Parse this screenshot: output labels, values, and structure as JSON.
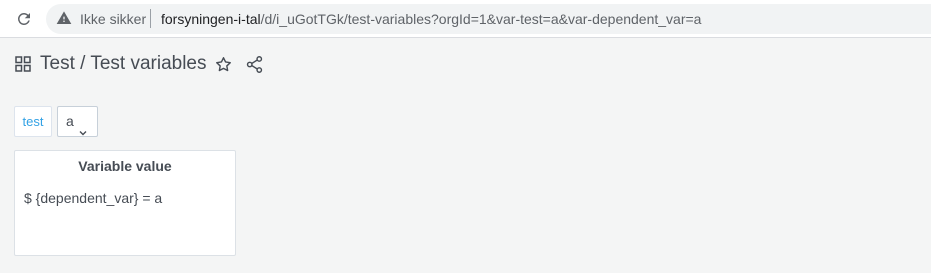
{
  "browser": {
    "security_label": "Ikke sikker",
    "url_host": "forsyningen-i-tal",
    "url_path": "/d/i_uGotTGk/test-variables?orgId=1&var-test=a&var-dependent_var=a",
    "icons": {
      "reload": "reload-icon",
      "warning": "warning-icon"
    }
  },
  "header": {
    "title": "Test / Test variables",
    "icons": {
      "dashboard": "dashboard-grid-icon",
      "star": "star-icon",
      "share": "share-icon"
    }
  },
  "variables": [
    {
      "label": "test",
      "selected": "a"
    }
  ],
  "panel": {
    "title": "Variable value",
    "content": "$ {dependent_var} = a"
  },
  "colors": {
    "accent_link": "#33a2e5",
    "text": "#464c54",
    "background": "#f4f5f5"
  }
}
